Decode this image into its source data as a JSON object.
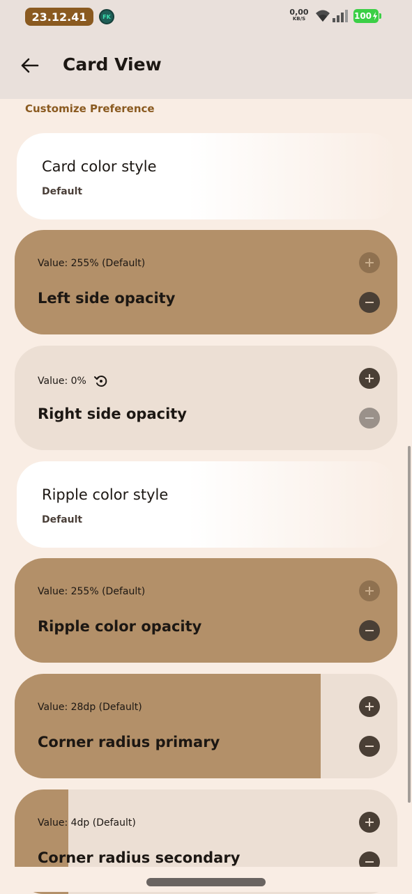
{
  "status_bar": {
    "time": "23.12.41",
    "app_badge": "FK",
    "net_speed_value": "0,00",
    "net_speed_unit": "KB/S",
    "battery": "100",
    "icons": [
      "wifi-icon",
      "signal-icon",
      "battery-charging-icon"
    ]
  },
  "app_bar": {
    "title": "Card View",
    "back_icon": "arrow-left-icon"
  },
  "section": {
    "label": "Customize Preference"
  },
  "cards": [
    {
      "type": "option",
      "title": "Card color style",
      "subtitle": "Default"
    },
    {
      "type": "slider",
      "value": "Value: 255% (Default)",
      "label": "Left side opacity",
      "fill_fraction": 1.0,
      "plus_enabled": false,
      "minus_enabled": true
    },
    {
      "type": "slider",
      "value": "Value: 0%",
      "label": "Right side opacity",
      "fill_fraction": 0.0,
      "plus_enabled": true,
      "minus_enabled": false,
      "reset_icon": "reset-icon"
    },
    {
      "type": "option",
      "title": "Ripple color style",
      "subtitle": "Default"
    },
    {
      "type": "slider",
      "value": "Value: 255% (Default)",
      "label": "Ripple color opacity",
      "fill_fraction": 1.0,
      "plus_enabled": false,
      "minus_enabled": true
    },
    {
      "type": "slider",
      "value": "Value: 28dp (Default)",
      "label": "Corner radius primary",
      "fill_fraction": 0.8,
      "plus_enabled": true,
      "minus_enabled": true
    },
    {
      "type": "slider",
      "value": "Value: 4dp (Default)",
      "label": "Corner radius secondary",
      "fill_fraction": 0.14,
      "plus_enabled": true,
      "minus_enabled": true
    }
  ],
  "colors": {
    "accent": "#8a5a20",
    "slider_fill": "#b39069",
    "slider_track": "#ecdfd4",
    "background": "#f9ede4",
    "app_bar": "#e9e0db"
  }
}
